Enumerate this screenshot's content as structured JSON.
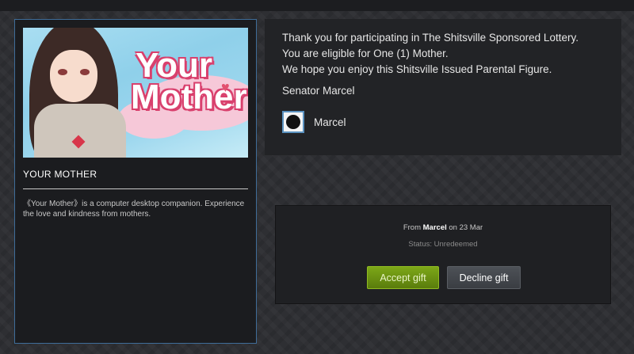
{
  "game": {
    "art_title_line1": "Your",
    "art_title_line2": "Mother",
    "title": "YOUR MOTHER",
    "description": "《Your Mother》is a computer desktop companion. Experience the love and kindness from mothers."
  },
  "message": {
    "lines": [
      "Thank you for participating in The Shitsville Sponsored Lottery.",
      "You are eligible for One (1) Mother.",
      "We hope you enjoy this Shitsville Issued Parental Figure."
    ],
    "signature": "Senator Marcel",
    "sender_name": "Marcel"
  },
  "gift": {
    "from_prefix": "From",
    "from_name": "Marcel",
    "from_suffix": "on 23 Mar",
    "status": "Status: Unredeemed",
    "accept_label": "Accept gift",
    "decline_label": "Decline gift"
  },
  "colors": {
    "accent_border": "#3f6d99",
    "accept_green": "#7da818",
    "title_pink": "#d9406d"
  },
  "icons": {
    "avatar": "avatar-icon",
    "heart": "heart-icon"
  }
}
